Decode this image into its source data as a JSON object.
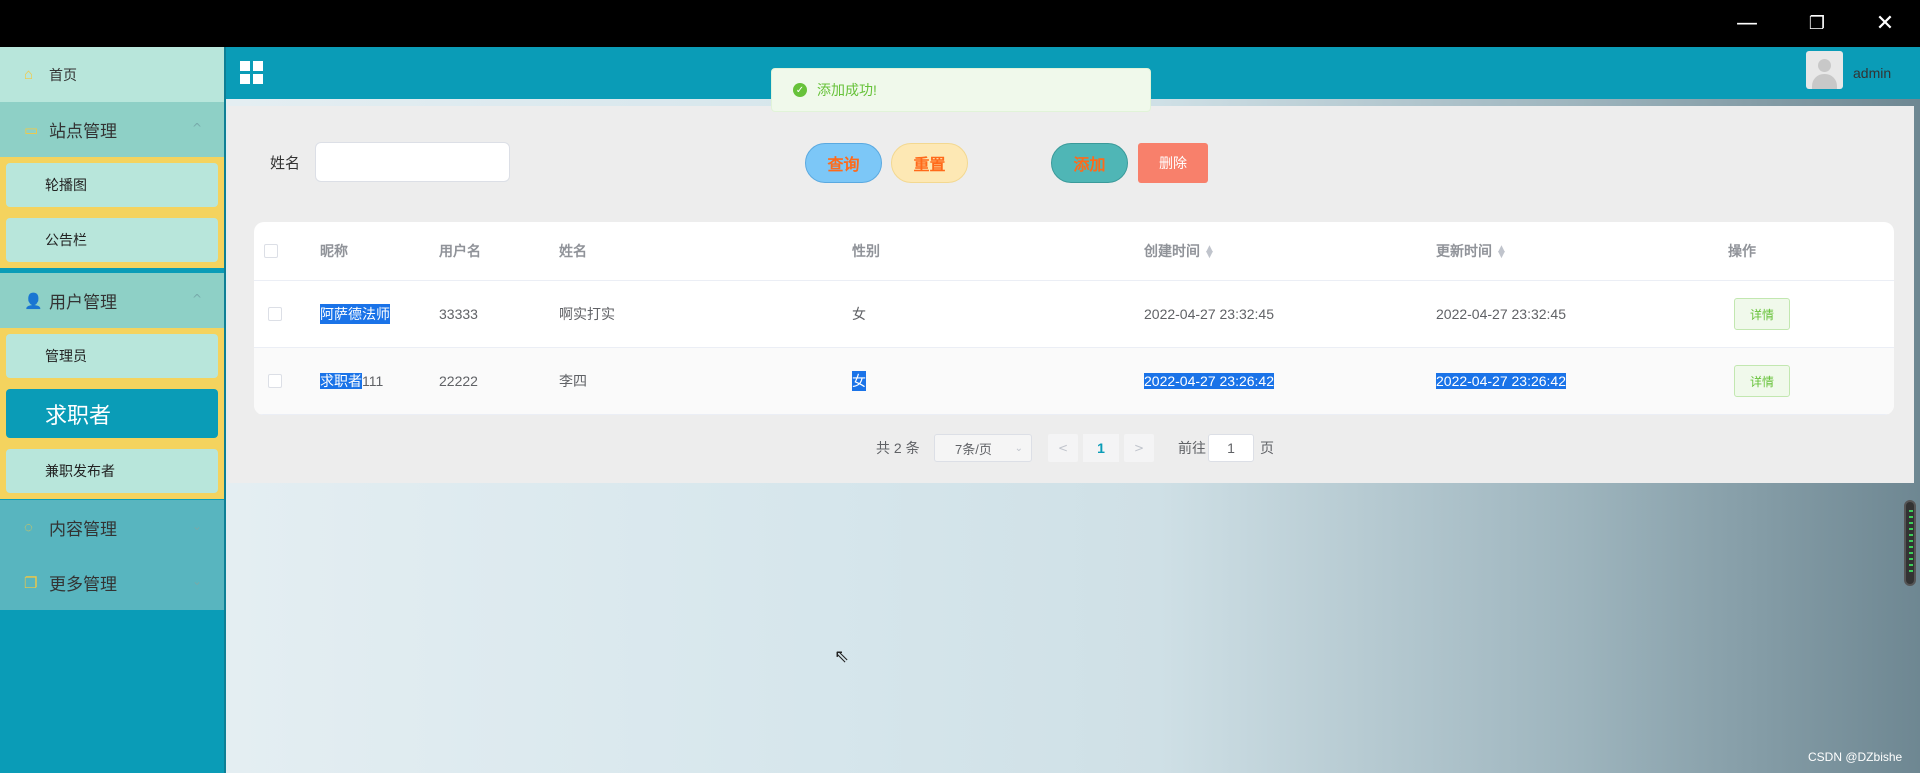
{
  "window": {
    "min_glyph": "—",
    "max_glyph": "❐",
    "close_glyph": "✕"
  },
  "sidebar": {
    "home": {
      "label": "首页",
      "icon": "home-icon"
    },
    "groups": [
      {
        "label": "站点管理",
        "icon": "monitor-icon",
        "expanded": true,
        "items": [
          "轮播图",
          "公告栏"
        ]
      },
      {
        "label": "用户管理",
        "icon": "user-icon",
        "expanded": true,
        "items": [
          "管理员",
          "求职者",
          "兼职发布者"
        ],
        "active": "求职者"
      },
      {
        "label": "内容管理",
        "icon": "chat-icon",
        "expanded": false
      },
      {
        "label": "更多管理",
        "icon": "copy-icon",
        "expanded": false
      }
    ]
  },
  "topbar": {
    "title": "",
    "user": "admin"
  },
  "toast": {
    "message": "添加成功!",
    "type": "success"
  },
  "search": {
    "label": "姓名",
    "value": "",
    "buttons": {
      "query": "查询",
      "reset": "重置",
      "add": "添加",
      "delete": "删除"
    }
  },
  "table": {
    "headers": [
      "昵称",
      "用户名",
      "姓名",
      "性别",
      "创建时间",
      "更新时间",
      "操作"
    ],
    "rows": [
      {
        "nickname": "阿萨德法师",
        "username": "33333",
        "name": "啊实打实",
        "gender": "女",
        "created": "2022-04-27 23:32:45",
        "updated": "2022-04-27 23:32:45",
        "action": "详情"
      },
      {
        "nickname_sel": "求职者",
        "nickname_rest": "111",
        "username": "22222",
        "name": "李四",
        "gender": "女",
        "created": "2022-04-27 23:26:42",
        "updated": "2022-04-27 23:26:42",
        "action": "详情"
      }
    ]
  },
  "pagination": {
    "total": "共 2 条",
    "page_size": "7条/页",
    "current": "1",
    "goto_label": "前往",
    "goto_value": "1",
    "page_suffix": "页"
  },
  "watermark": "CSDN @DZbishe",
  "colors": {
    "primary": "#0a9cb7",
    "sidebar_item": "#b8e6db",
    "sidebar_group": "#8ed0c6",
    "highlight": "#f4d35e",
    "success": "#67c23a",
    "danger": "#f8806b"
  }
}
